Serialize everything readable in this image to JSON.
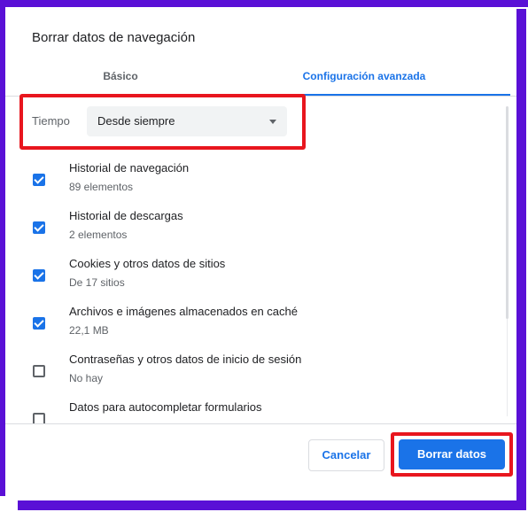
{
  "dialog": {
    "title": "Borrar datos de navegación",
    "tabs": [
      {
        "label": "Básico",
        "active": false
      },
      {
        "label": "Configuración avanzada",
        "active": true
      }
    ],
    "time_range": {
      "label": "Tiempo",
      "selected": "Desde siempre"
    },
    "items": [
      {
        "title": "Historial de navegación",
        "subtitle": "89 elementos",
        "checked": true
      },
      {
        "title": "Historial de descargas",
        "subtitle": "2 elementos",
        "checked": true
      },
      {
        "title": "Cookies y otros datos de sitios",
        "subtitle": "De 17 sitios",
        "checked": true
      },
      {
        "title": "Archivos e imágenes almacenados en caché",
        "subtitle": "22,1 MB",
        "checked": true
      },
      {
        "title": "Contraseñas y otros datos de inicio de sesión",
        "subtitle": "No hay",
        "checked": false
      },
      {
        "title": "Datos para autocompletar formularios",
        "subtitle": "",
        "checked": false
      }
    ],
    "buttons": {
      "cancel": "Cancelar",
      "clear": "Borrar datos"
    }
  },
  "colors": {
    "accent": "#1a73e8",
    "highlight": "#e8161e",
    "frame": "#5a10d6"
  }
}
